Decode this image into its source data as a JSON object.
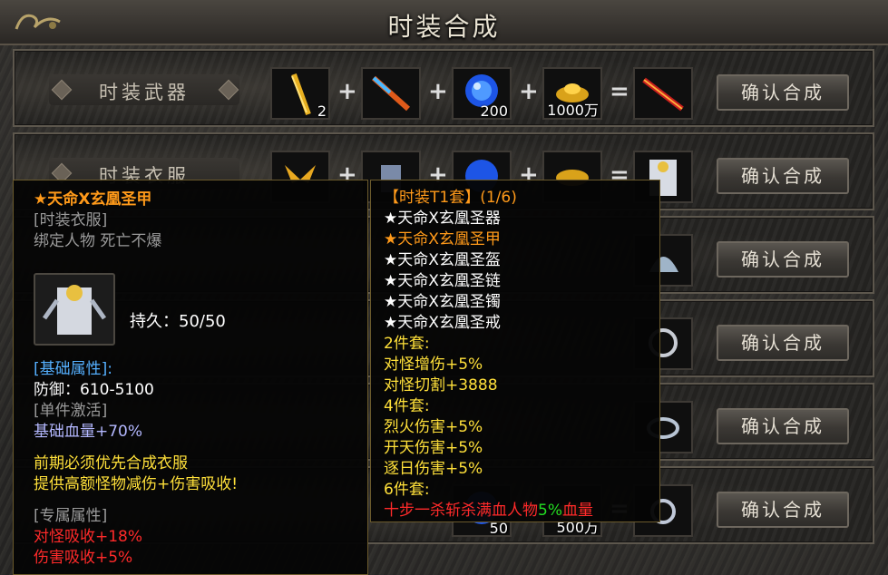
{
  "window": {
    "title": "时装合成"
  },
  "rows": [
    {
      "category": "时装武器",
      "counts": [
        "2",
        "",
        "200",
        "1000万"
      ],
      "confirm": "确认合成"
    },
    {
      "category": "时装衣服",
      "counts": [
        "",
        "",
        "",
        ""
      ],
      "confirm": "确认合成"
    },
    {
      "confirm": "确认合成"
    },
    {
      "confirm": "确认合成"
    },
    {
      "confirm": "确认合成"
    },
    {
      "confirm": "确认合成",
      "counts_visible": [
        "50",
        "500万"
      ]
    }
  ],
  "operators": {
    "plus": "+",
    "equals": "="
  },
  "item_tooltip": {
    "name": "★天命X玄凰圣甲",
    "type": "[时装衣服]",
    "binding": "绑定人物 死亡不爆",
    "durability": "持久：50/50",
    "base_header": "[基础属性]:",
    "defense": "防御：610-5100",
    "single_header": "[单件激活]",
    "hp_bonus": "基础血量+70%",
    "desc1": "前期必须优先合成衣服",
    "desc2": "提供高额怪物减伤+伤害吸收!",
    "exclusive_header": "[专属属性]",
    "exclusive1": "对怪吸收+18%",
    "exclusive2": "伤害吸收+5%"
  },
  "set_tooltip": {
    "header": "【时装T1套】(1/6)",
    "pieces": [
      {
        "name": "★天命X玄凰圣器",
        "active": false
      },
      {
        "name": "★天命X玄凰圣甲",
        "active": true
      },
      {
        "name": "★天命X玄凰圣盔",
        "active": false
      },
      {
        "name": "★天命X玄凰圣链",
        "active": false
      },
      {
        "name": "★天命X玄凰圣镯",
        "active": false
      },
      {
        "name": "★天命X玄凰圣戒",
        "active": false
      }
    ],
    "set2_header": "2件套:",
    "set2_a": "对怪增伤+5%",
    "set2_b": "对怪切割+3888",
    "set4_header": "4件套:",
    "set4_a": "烈火伤害+5%",
    "set4_b": "开天伤害+5%",
    "set4_c": "逐日伤害+5%",
    "set6_header": "6件套:",
    "set6_red": "十步一杀斩杀满血人物",
    "set6_green": "5%",
    "set6_tail": "血量"
  },
  "colors": {
    "orange": "#ff9a1a",
    "yellow": "#ffe03a",
    "red": "#ff2a2a",
    "green": "#22dd22"
  }
}
